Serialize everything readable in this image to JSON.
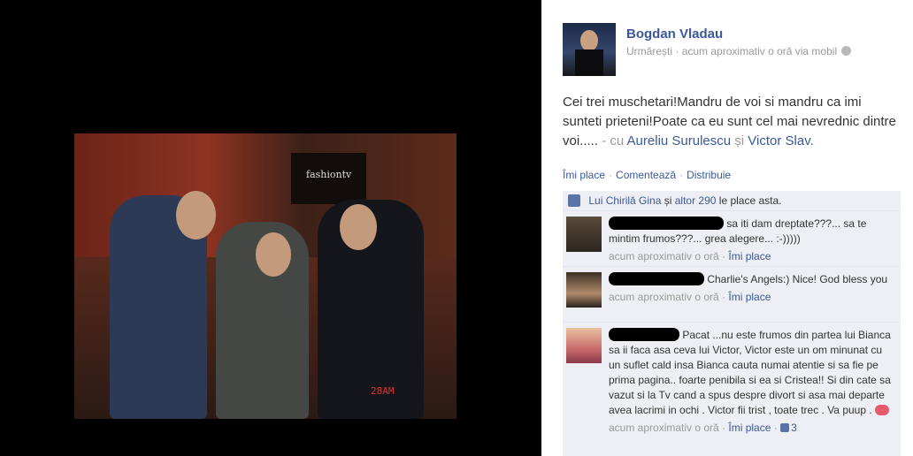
{
  "photo": {
    "sign_text": "fashiontv",
    "date_stamp": "28AM"
  },
  "post": {
    "author": "Bogdan Vladau",
    "follow_label": "Urmărești",
    "meta_text": "acum aproximativ o oră via mobil",
    "status_text": "Cei trei muschetari!Mandru de voi si mandru ca imi sunteti prieteni!Poate ca eu sunt cel mai nevrednic dintre voi.....",
    "with_prefix": "- cu",
    "tag1": "Aureliu Surulescu",
    "and_word": "și",
    "tag2": "Victor Slav.",
    "action_like": "Îmi place",
    "action_comment": "Comentează",
    "action_share": "Distribuie"
  },
  "likes": {
    "name1": "Lui Chirilă Gina",
    "and_word": "și",
    "others": "altor 290",
    "suffix": "le place asta."
  },
  "comments": [
    {
      "text": "sa iti dam dreptate???... sa te mintim frumos???... grea alegere... :-)))))",
      "time": "acum aproximativ o oră",
      "like_label": "Îmi place"
    },
    {
      "text": "Charlie's Angels:) Nice! God bless you",
      "time": "acum aproximativ o oră",
      "like_label": "Îmi place"
    },
    {
      "text": "Pacat ...nu este frumos din partea lui Bianca sa ii faca asa ceva lui Victor, Victor este un om minunat cu un suflet cald insa Bianca cauta numai atentie si sa fie pe prima pagina.. foarte penibila si ea si Cristea!! Si din cate sa vazut si la Tv cand a spus despre divort si asa mai departe avea lacrimi in ochi . Victor fii trist , toate trec . Va puup .",
      "time": "acum aproximativ o oră",
      "like_label": "Îmi place",
      "like_count": "3"
    }
  ],
  "colors": {
    "link": "#3b5998",
    "comment_bg": "#edeff4",
    "muted": "#999999"
  },
  "icons": [
    "globe-icon",
    "like-thumb-icon",
    "kiss-emoticon-icon"
  ]
}
